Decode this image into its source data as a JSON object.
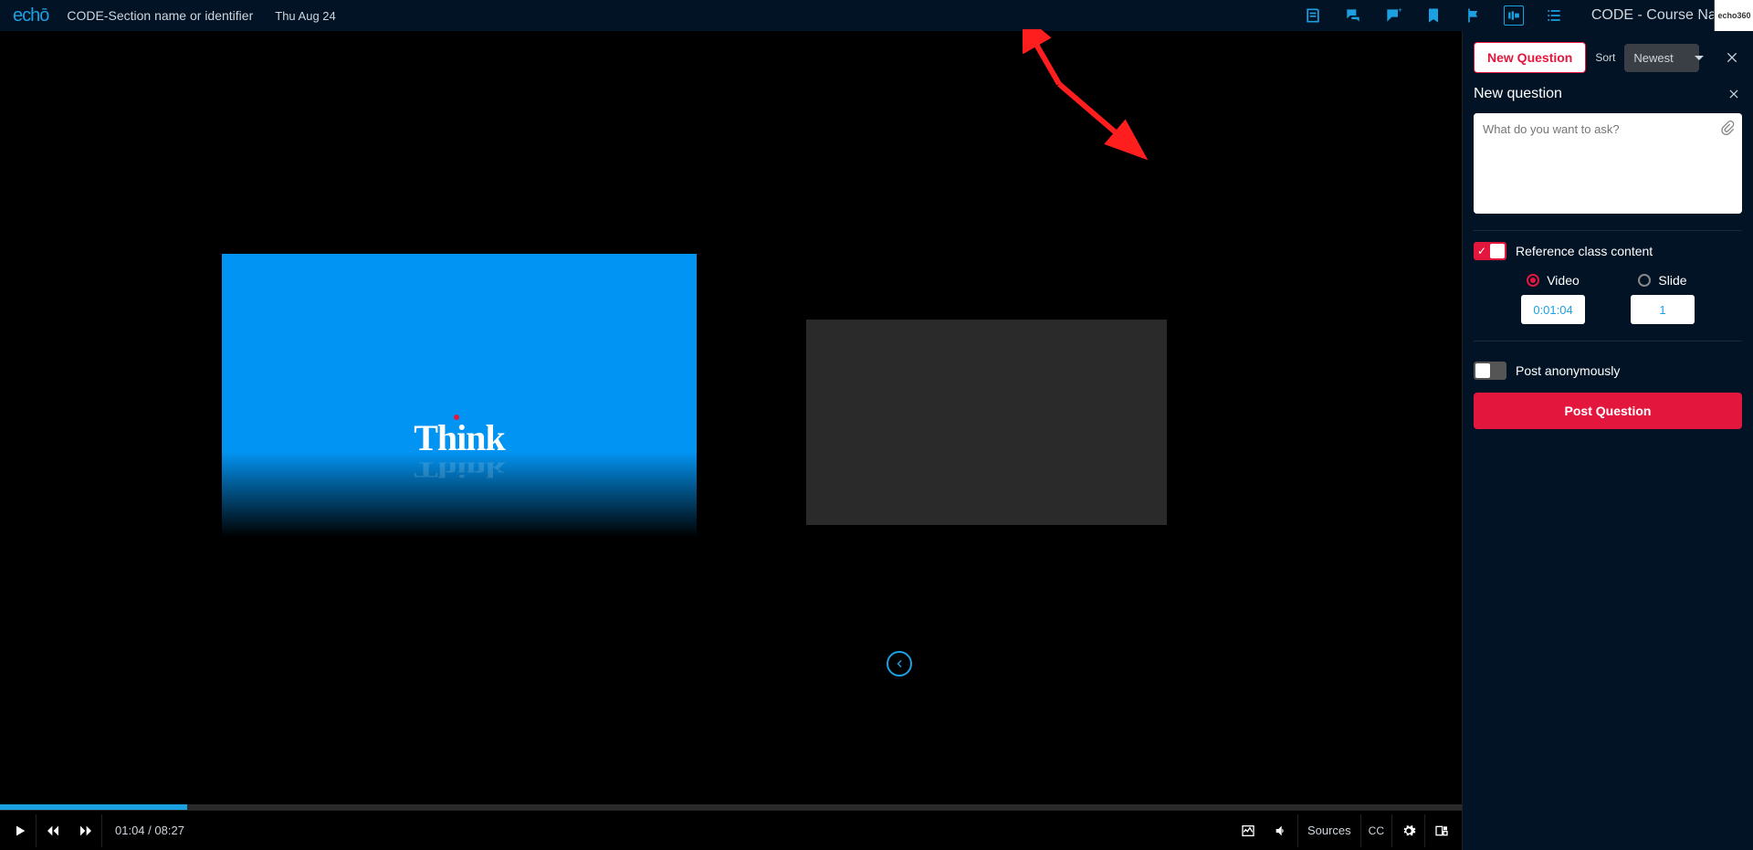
{
  "header": {
    "logo": "echō",
    "section_name": "CODE-Section name or identifier",
    "date": "Thu Aug 24",
    "course_name": "CODE - Course Name",
    "ext_label": "echo360"
  },
  "video": {
    "primary_text": "Think",
    "current_time": "01:04",
    "total_time": "08:27"
  },
  "controls": {
    "sources_label": "Sources",
    "cc_label": "CC"
  },
  "panel": {
    "new_question_btn": "New Question",
    "sort_label": "Sort",
    "sort_value": "Newest",
    "form_title": "New question",
    "question_placeholder": "What do you want to ask?",
    "reference_label": "Reference class content",
    "video_option_label": "Video",
    "video_option_value": "0:01:04",
    "slide_option_label": "Slide",
    "slide_option_value": "1",
    "anonymous_label": "Post anonymously",
    "post_btn": "Post Question"
  }
}
